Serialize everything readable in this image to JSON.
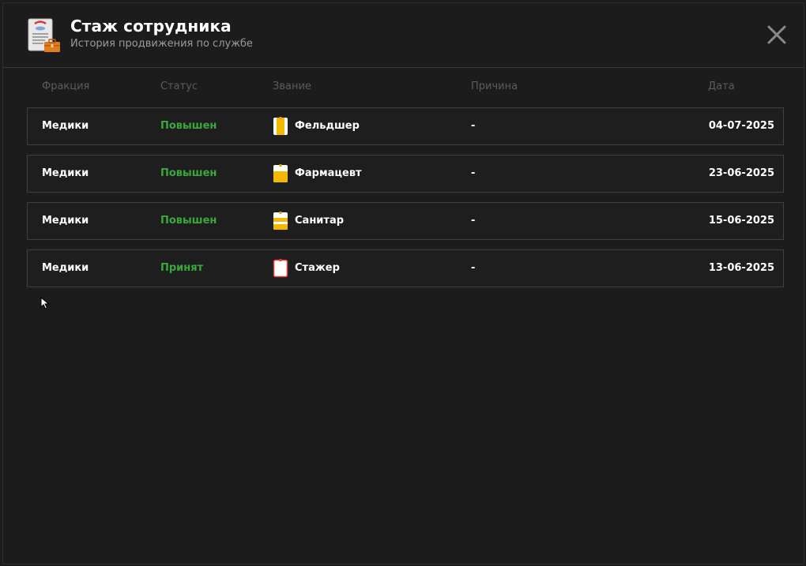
{
  "header": {
    "title": "Стаж сотрудника",
    "subtitle": "История продвижения по службе"
  },
  "columns": {
    "faction": "Фракция",
    "status": "Статус",
    "rank": "Звание",
    "reason": "Причина",
    "date": "Дата"
  },
  "rows": [
    {
      "faction": "Медики",
      "status": "Повышен",
      "rank": "Фельдшер",
      "rank_icon": "yellow-badge-icon",
      "reason": "-",
      "date": "04-07-2025"
    },
    {
      "faction": "Медики",
      "status": "Повышен",
      "rank": "Фармацевт",
      "rank_icon": "yellow-badge-icon",
      "reason": "-",
      "date": "23-06-2025"
    },
    {
      "faction": "Медики",
      "status": "Повышен",
      "rank": "Санитар",
      "rank_icon": "striped-badge-icon",
      "reason": "-",
      "date": "15-06-2025"
    },
    {
      "faction": "Медики",
      "status": "Принят",
      "rank": "Стажер",
      "rank_icon": "white-badge-icon",
      "reason": "-",
      "date": "13-06-2025"
    }
  ],
  "colors": {
    "background": "#1c1c1c",
    "status_green": "#3aa83a",
    "badge_yellow": "#f5b800",
    "badge_red": "#e03a3a"
  }
}
